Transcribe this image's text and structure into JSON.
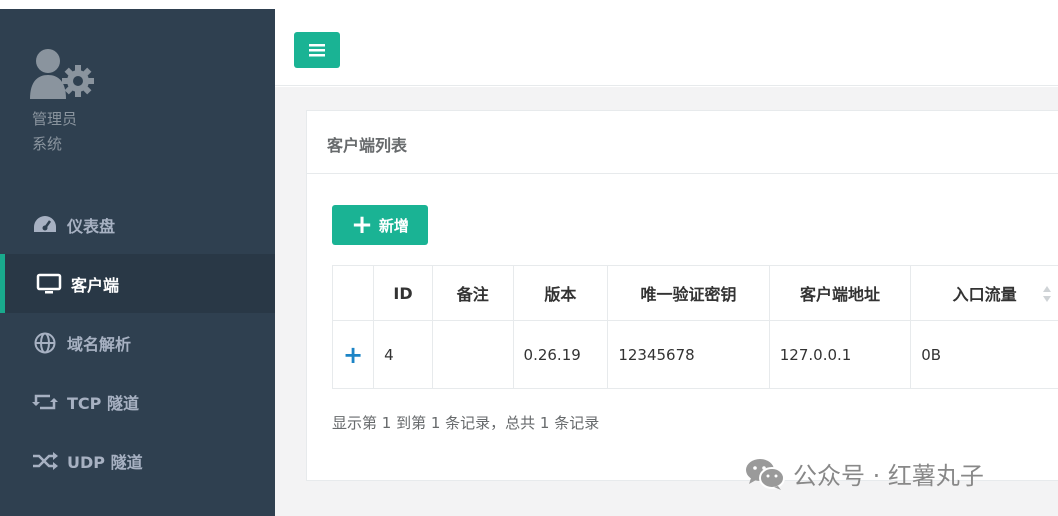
{
  "profile": {
    "role": "管理员",
    "dept": "系统"
  },
  "nav": {
    "items": [
      {
        "label": "仪表盘",
        "icon": "dashboard-icon"
      },
      {
        "label": "客户端",
        "icon": "monitor-icon",
        "active": true
      },
      {
        "label": "域名解析",
        "icon": "globe-icon"
      },
      {
        "label": "TCP 隧道",
        "icon": "retweet-icon"
      },
      {
        "label": "UDP 隧道",
        "icon": "random-icon"
      }
    ]
  },
  "panel": {
    "title": "客户端列表",
    "add_label": "新增"
  },
  "table": {
    "headers": [
      "ID",
      "备注",
      "版本",
      "唯一验证密钥",
      "客户端地址",
      "入口流量"
    ],
    "rows": [
      {
        "id": "4",
        "note": "",
        "version": "0.26.19",
        "key": "12345678",
        "address": "127.0.0.1",
        "flow": "0B"
      }
    ]
  },
  "pager_text": "显示第 1 到第 1 条记录，总共 1 条记录",
  "watermark": "公众号 · 红薯丸子",
  "colors": {
    "sidebar": "#2f4050",
    "accent": "#1ab394",
    "expand": "#1c84c6"
  }
}
